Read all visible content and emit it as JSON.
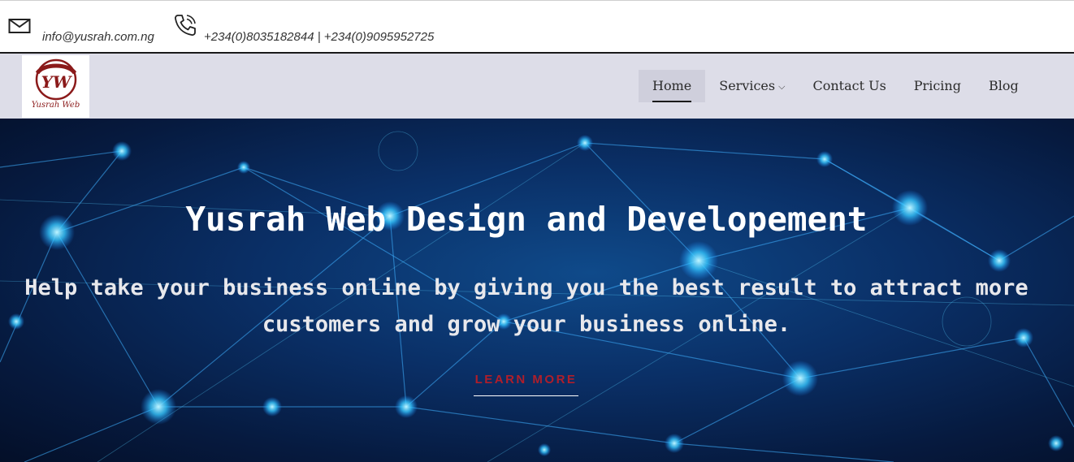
{
  "contact": {
    "email": "info@yusrah.com.ng",
    "phones": "+234(0)8035182844 | +234(0)9095952725",
    "email_icon": "envelope-icon",
    "phone_icon": "phone-icon"
  },
  "logo": {
    "monogram": "YW",
    "script": "Yusrah Web",
    "brand_color": "#8b1a1a"
  },
  "nav": {
    "items": [
      {
        "label": "Home",
        "active": true
      },
      {
        "label": "Services",
        "has_dropdown": true
      },
      {
        "label": "Contact Us"
      },
      {
        "label": "Pricing"
      },
      {
        "label": "Blog"
      }
    ],
    "dropdown_icon": "chevron-down-icon"
  },
  "hero": {
    "title": "Yusrah Web Design and Developement",
    "subtitle": "Help take your business online by giving you the best result to attract more customers and grow your business online.",
    "cta": "LEARN MORE",
    "cta_color": "#b01e2a"
  }
}
